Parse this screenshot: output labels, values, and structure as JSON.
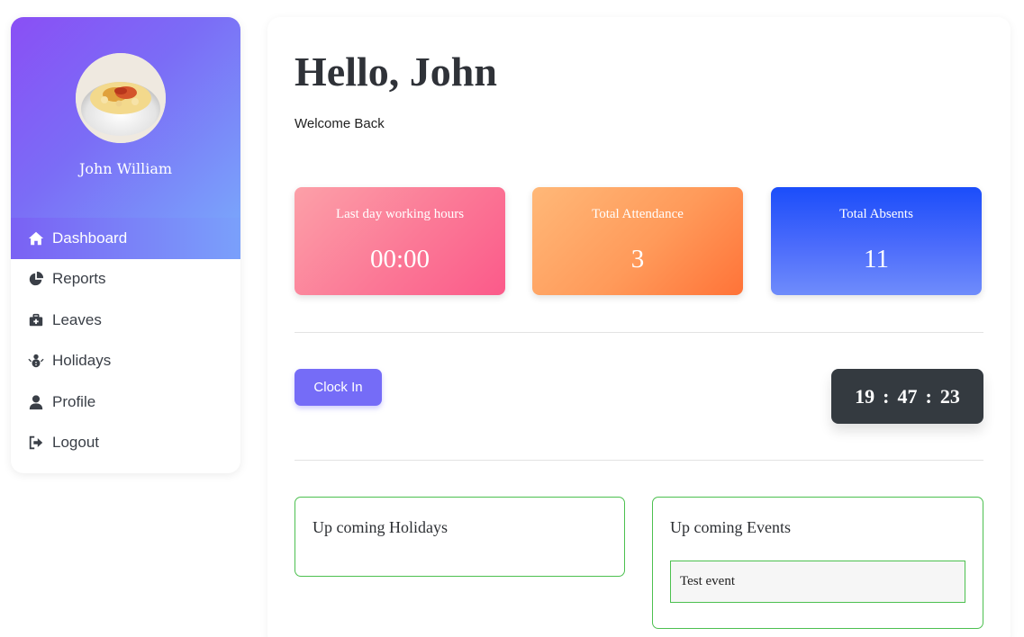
{
  "sidebar": {
    "user_name": "John William",
    "items": [
      {
        "label": "Dashboard",
        "icon": "home-icon",
        "active": true
      },
      {
        "label": "Reports",
        "icon": "pie-chart-icon"
      },
      {
        "label": "Leaves",
        "icon": "medical-kit-icon"
      },
      {
        "label": "Holidays",
        "icon": "snowman-icon"
      },
      {
        "label": "Profile",
        "icon": "user-icon"
      },
      {
        "label": "Logout",
        "icon": "sign-out-icon"
      }
    ]
  },
  "main": {
    "greeting": "Hello, John",
    "welcome": "Welcome Back",
    "stats": [
      {
        "label": "Last day working hours",
        "value": "00:00"
      },
      {
        "label": "Total Attendance",
        "value": "3"
      },
      {
        "label": "Total Absents",
        "value": "11"
      }
    ],
    "clock_in_label": "Clock In",
    "clock": {
      "hours": "19",
      "minutes": "47",
      "seconds": "23",
      "separator": ":"
    },
    "holidays_title": "Up coming Holidays",
    "events_title": "Up coming Events",
    "events": [
      "Test event"
    ]
  },
  "colors": {
    "accent": "#756cf7",
    "sidebar_gradient_start": "#8a4ff5",
    "sidebar_gradient_end": "#7aa3fb",
    "panel_border": "#4cc04f",
    "clock_bg": "#343a40"
  }
}
